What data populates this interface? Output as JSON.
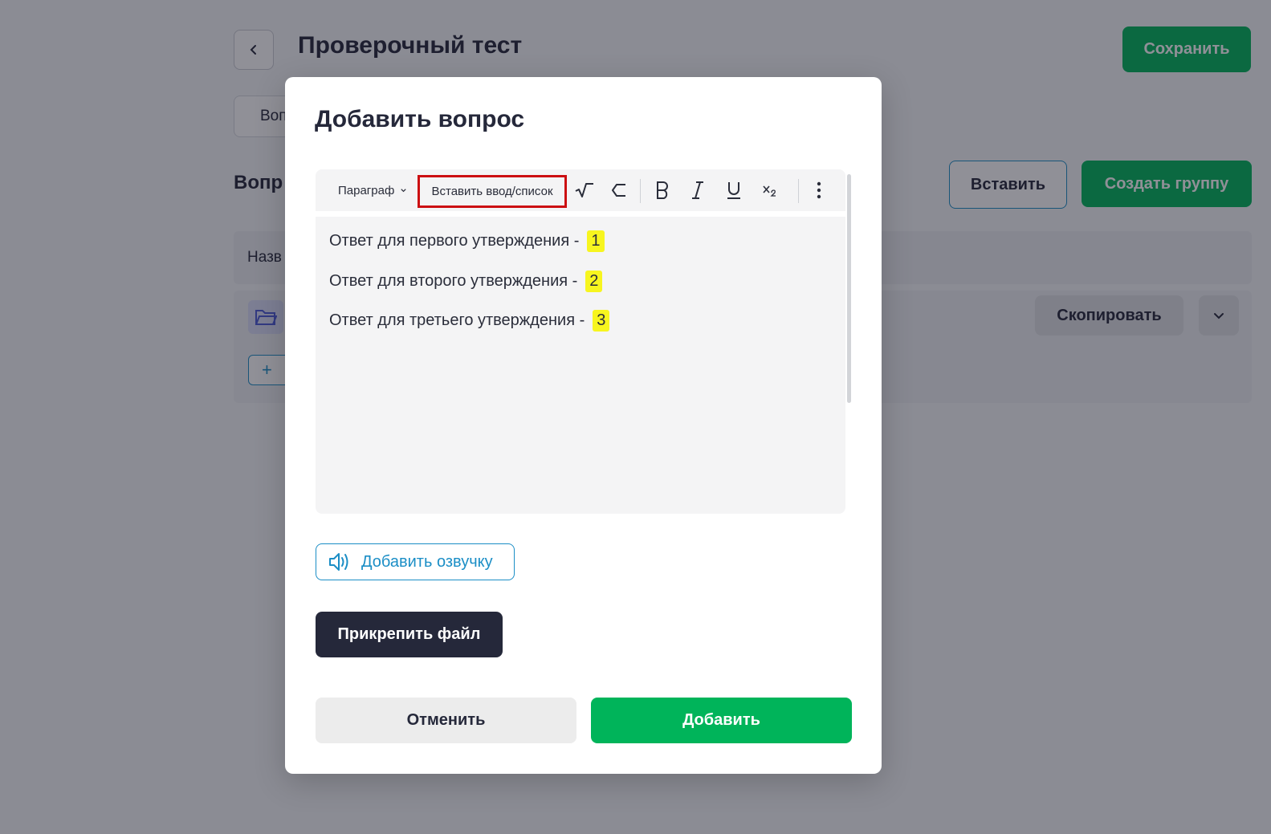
{
  "background_page": {
    "title": "Проверочный тест",
    "save_label": "Сохранить",
    "tab_label": "Воп",
    "section_heading": "Вопр",
    "insert_label": "Вставить",
    "create_group_label": "Создать группу",
    "table_header_label": "Назв",
    "copy_label": "Скопировать",
    "add_row_symbol": "+"
  },
  "modal": {
    "title": "Добавить вопрос",
    "toolbar": {
      "paragraph_label": "Параграф",
      "insert_input_label": "Вставить ввод/список",
      "icons": [
        "sqrt-icon",
        "hexagon-icon",
        "bold-icon",
        "italic-icon",
        "underline-icon",
        "subscript-icon",
        "more-vertical-icon"
      ],
      "highlight_color": "#cc0f12"
    },
    "editor": {
      "lines": [
        {
          "text": "Ответ для первого утверждения -",
          "marker": "1"
        },
        {
          "text": "Ответ для второго утверждения -",
          "marker": "2"
        },
        {
          "text": "Ответ для третьего утверждения -",
          "marker": "3"
        }
      ],
      "marker_color": "#f7f51f"
    },
    "voice_label": "Добавить озвучку",
    "attach_label": "Прикрепить файл",
    "cancel_label": "Отменить",
    "add_label": "Добавить"
  },
  "colors": {
    "primary_green": "#00b45a",
    "dark": "#25283a",
    "link_blue": "#1b8ec6"
  }
}
